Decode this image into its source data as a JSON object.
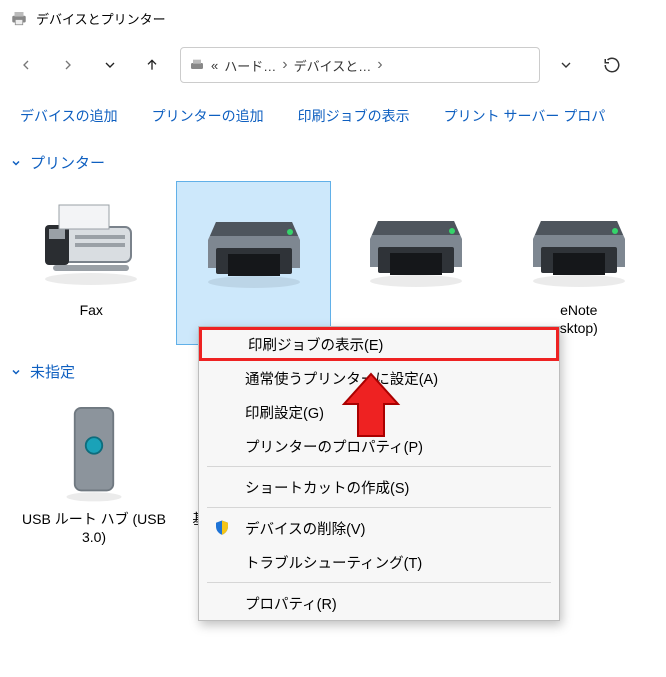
{
  "window": {
    "title": "デバイスとプリンター"
  },
  "breadcrumb": {
    "prefix": "«",
    "seg1": "ハード…",
    "seg2": "デバイスと…"
  },
  "toolbar": {
    "add_device": "デバイスの追加",
    "add_printer": "プリンターの追加",
    "show_jobs": "印刷ジョブの表示",
    "server_props": "プリント サーバー プロパ"
  },
  "groups": {
    "printer": "プリンター",
    "unspecified": "未指定"
  },
  "printers": {
    "fax": "Fax",
    "onenote1": "eNote",
    "onenote2": "sktop)"
  },
  "unspecified": {
    "usb": "USB ルート ハブ (USB 3.0)",
    "basic": "基本システムデバイス"
  },
  "context_menu": {
    "show_jobs": "印刷ジョブの表示(E)",
    "set_default": "通常使うプリンターに設定(A)",
    "print_prefs": "印刷設定(G)",
    "printer_props": "プリンターのプロパティ(P)",
    "create_shortcut": "ショートカットの作成(S)",
    "delete_device": "デバイスの削除(V)",
    "troubleshoot": "トラブルシューティング(T)",
    "properties": "プロパティ(R)"
  }
}
